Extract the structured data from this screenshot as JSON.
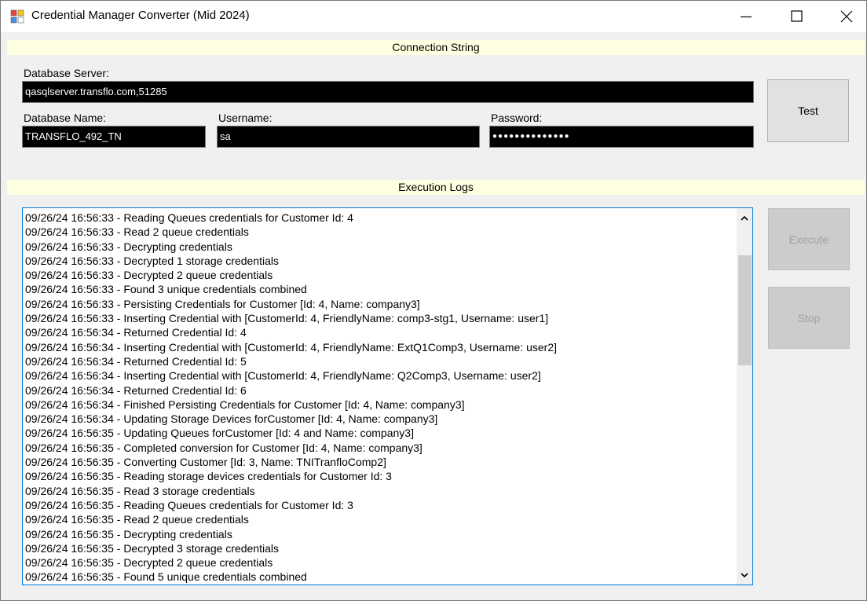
{
  "window": {
    "title": "Credential Manager Converter (Mid 2024)"
  },
  "icons": {
    "app": "app-grid-icon",
    "minimize": "minimize-icon",
    "maximize": "maximize-icon",
    "close": "close-icon",
    "scroll_up": "chevron-up-icon",
    "scroll_down": "chevron-down-icon"
  },
  "connection": {
    "section_title": "Connection String",
    "server_label": "Database Server:",
    "server_value": "qasqlserver.transflo.com,51285",
    "dbname_label": "Database Name:",
    "dbname_value": "TRANSFLO_492_TN",
    "username_label": "Username:",
    "username_value": "sa",
    "password_label": "Password:",
    "password_value": "●●●●●●●●●●●●●●",
    "test_button": "Test"
  },
  "logs": {
    "section_title": "Execution Logs",
    "execute_button": "Execute",
    "stop_button": "Stop",
    "lines": [
      "09/26/24 16:56:33 - Reading Queues credentials for Customer Id: 4",
      "09/26/24 16:56:33 - Read 2 queue credentials",
      "09/26/24 16:56:33 - Decrypting credentials",
      "09/26/24 16:56:33 - Decrypted 1 storage credentials",
      "09/26/24 16:56:33 - Decrypted 2 queue credentials",
      "09/26/24 16:56:33 - Found 3 unique credentials combined",
      "09/26/24 16:56:33 - Persisting Credentials for Customer [Id: 4, Name: company3]",
      "09/26/24 16:56:33 - Inserting Credential with [CustomerId: 4, FriendlyName: comp3-stg1, Username: user1]",
      "09/26/24 16:56:34 - Returned Credential Id: 4",
      "09/26/24 16:56:34 - Inserting Credential with [CustomerId: 4, FriendlyName: ExtQ1Comp3, Username: user2]",
      "09/26/24 16:56:34 - Returned Credential Id: 5",
      "09/26/24 16:56:34 - Inserting Credential with [CustomerId: 4, FriendlyName: Q2Comp3, Username: user2]",
      "09/26/24 16:56:34 - Returned Credential Id: 6",
      "09/26/24 16:56:34 - Finished Persisting Credentials for Customer [Id: 4, Name: company3]",
      "09/26/24 16:56:34 - Updating Storage Devices forCustomer [Id: 4, Name: company3]",
      "09/26/24 16:56:35 - Updating Queues forCustomer [Id: 4 and Name: company3]",
      "09/26/24 16:56:35 - Completed conversion for Customer [Id: 4, Name: company3]",
      "09/26/24 16:56:35 - Converting Customer [Id: 3, Name: TNITranfloComp2]",
      "09/26/24 16:56:35 - Reading storage devices credentials for Customer Id: 3",
      "09/26/24 16:56:35 - Read 3 storage credentials",
      "09/26/24 16:56:35 - Reading Queues credentials for Customer Id: 3",
      "09/26/24 16:56:35 - Read 2 queue credentials",
      "09/26/24 16:56:35 - Decrypting credentials",
      "09/26/24 16:56:35 - Decrypted 3 storage credentials",
      "09/26/24 16:56:35 - Decrypted 2 queue credentials",
      "09/26/24 16:56:35 - Found 5 unique credentials combined"
    ]
  }
}
